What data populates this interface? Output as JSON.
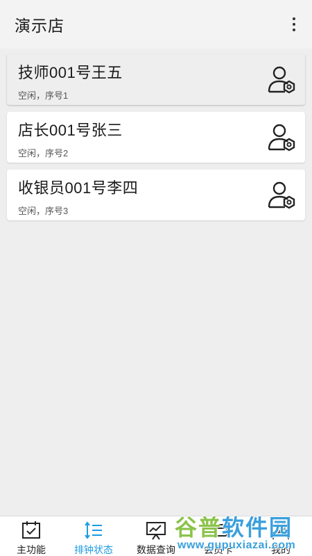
{
  "header": {
    "title": "演示店",
    "menu_icon": "more-vertical-icon"
  },
  "staff": [
    {
      "name": "技师001号王五",
      "status": "空闲，序号1",
      "icon": "user-settings-icon",
      "selected": true
    },
    {
      "name": "店长001号张三",
      "status": "空闲，序号2",
      "icon": "user-settings-icon",
      "selected": false
    },
    {
      "name": "收银员001号李四",
      "status": "空闲，序号3",
      "icon": "user-settings-icon",
      "selected": false
    }
  ],
  "bottom_nav": {
    "tabs": [
      {
        "label": "主功能",
        "icon": "calendar-check-icon"
      },
      {
        "label": "排钟状态",
        "icon": "sort-list-icon",
        "active": true
      },
      {
        "label": "数据查询",
        "icon": "chart-board-icon"
      },
      {
        "label": "会员卡",
        "icon": "card-icon"
      },
      {
        "label": "我的",
        "icon": "person-icon"
      }
    ]
  },
  "watermark": {
    "brand_green": "谷普",
    "brand_blue": "软件园",
    "url": "www.gupuxiazai.com"
  },
  "colors": {
    "accent": "#1e9be0",
    "background": "#eeeeee",
    "card": "#ffffff"
  }
}
